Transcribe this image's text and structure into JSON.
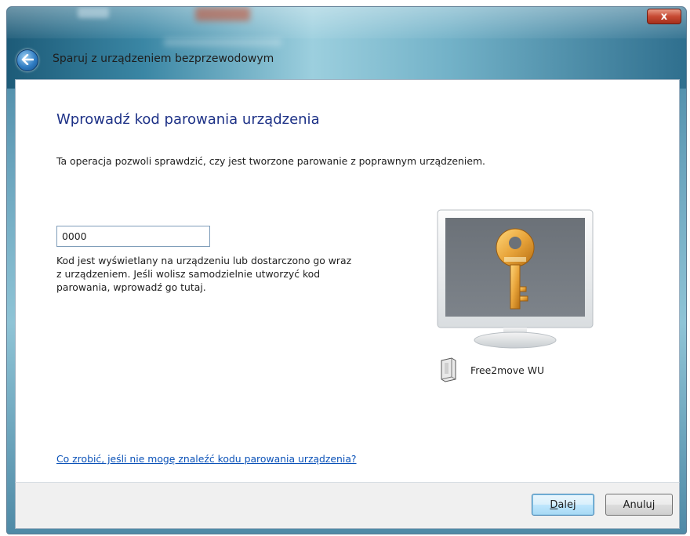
{
  "window": {
    "title": "Sparuj z urządzeniem bezprzewodowym",
    "close_label": "x"
  },
  "page": {
    "heading": "Wprowadź kod parowania urządzenia",
    "description": "Ta operacja pozwoli sprawdzić, czy jest tworzone parowanie z poprawnym urządzeniem.",
    "pin_value": "0000",
    "hint_lines": [
      "Kod jest wyświetlany na urządzeniu lub dostarczono go wraz",
      "z urządzeniem. Jeśli wolisz samodzielnie utworzyć kod",
      "parowania, wprowadź go tutaj."
    ],
    "device_name": "Free2move WU",
    "help_link": "Co zrobić, jeśli nie mogę znaleźć kodu parowania urządzenia?"
  },
  "footer": {
    "next_label": "Dalej",
    "next_access_key": "D",
    "next_rest": "alej",
    "cancel_label": "Anuluj"
  },
  "icons": {
    "back": "back-arrow-icon",
    "monitor": "monitor-key-icon",
    "device": "wireless-device-icon"
  }
}
